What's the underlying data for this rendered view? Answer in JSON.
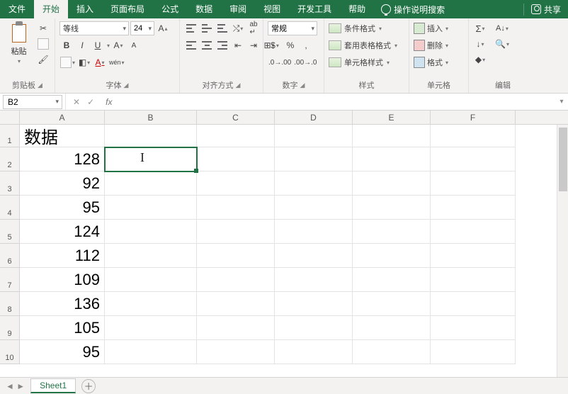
{
  "tabs": {
    "file": "文件",
    "home": "开始",
    "insert": "插入",
    "layout": "页面布局",
    "formulas": "公式",
    "data": "数据",
    "review": "审阅",
    "view": "视图",
    "dev": "开发工具",
    "help": "帮助",
    "tell": "操作说明搜索",
    "share": "共享"
  },
  "ribbon": {
    "clipboard": {
      "paste": "粘贴",
      "label": "剪贴板"
    },
    "font": {
      "name": "等线",
      "size": "24",
      "bold": "B",
      "italic": "I",
      "underline": "U",
      "label": "字体"
    },
    "align": {
      "label": "对齐方式"
    },
    "number": {
      "format": "常规",
      "label": "数字"
    },
    "styles": {
      "cond": "条件格式",
      "table": "套用表格格式",
      "cell": "单元格样式",
      "label": "样式"
    },
    "cells": {
      "insert": "插入",
      "delete": "删除",
      "format": "格式",
      "label": "单元格"
    },
    "editing": {
      "label": "编辑"
    }
  },
  "namebox": "B2",
  "formula": "",
  "columns": [
    "A",
    "B",
    "C",
    "D",
    "E",
    "F"
  ],
  "rows": [
    "1",
    "2",
    "3",
    "4",
    "5",
    "6",
    "7",
    "8",
    "9",
    "10"
  ],
  "cells": {
    "a1": "数据",
    "a2": "128",
    "a3": "92",
    "a4": "95",
    "a5": "124",
    "a6": "112",
    "a7": "109",
    "a8": "136",
    "a9": "105",
    "a10": "95"
  },
  "sheet": "Sheet1"
}
